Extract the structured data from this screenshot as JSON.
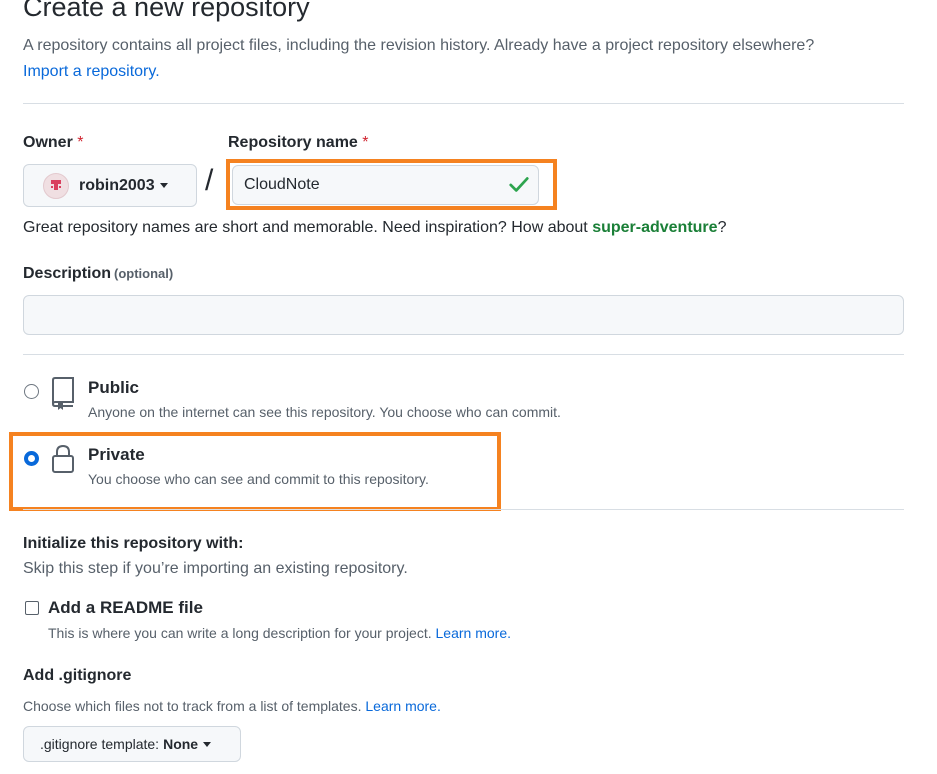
{
  "header": {
    "title": "Create a new repository",
    "subtitle": "A repository contains all project files, including the revision history. Already have a project repository elsewhere?",
    "import_link": "Import a repository."
  },
  "owner": {
    "label": "Owner",
    "required_mark": "*",
    "value": "robin2003"
  },
  "separator": "/",
  "repo_name": {
    "label": "Repository name",
    "required_mark": "*",
    "value": "CloudNote",
    "valid": true
  },
  "name_hint": {
    "text": "Great repository names are short and memorable. Need inspiration? How about ",
    "suggestion": "super-adventure",
    "end": "?"
  },
  "description": {
    "label": "Description",
    "optional": "(optional)",
    "value": ""
  },
  "visibility": {
    "selected": "Private",
    "options": [
      {
        "title": "Public",
        "desc": "Anyone on the internet can see this repository. You choose who can commit.",
        "icon": "repo-icon"
      },
      {
        "title": "Private",
        "desc": "You choose who can see and commit to this repository.",
        "icon": "lock-icon"
      }
    ]
  },
  "initialize": {
    "title": "Initialize this repository with:",
    "subtitle": "Skip this step if you’re importing an existing repository.",
    "readme": {
      "label": "Add a README file",
      "desc": "This is where you can write a long description for your project.",
      "link": "Learn more.",
      "checked": false
    }
  },
  "gitignore": {
    "title": "Add .gitignore",
    "desc": "Choose which files not to track from a list of templates.",
    "link": "Learn more.",
    "button_prefix": ".gitignore template:",
    "button_value": "None"
  },
  "colors": {
    "highlight": "#f58220",
    "link": "#0969da",
    "success": "#1a7f37",
    "required": "#cf222e"
  }
}
